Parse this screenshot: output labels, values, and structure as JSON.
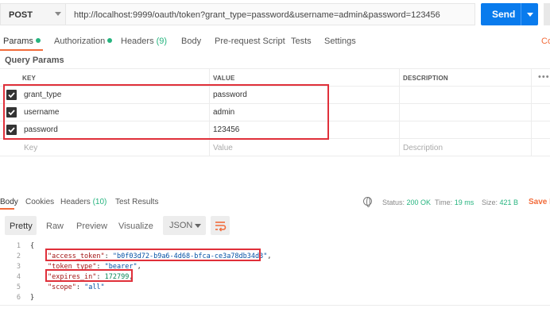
{
  "request": {
    "method": "POST",
    "url": "http://localhost:9999/oauth/token?grant_type=password&username=admin&password=123456",
    "send_label": "Send"
  },
  "tabs": [
    {
      "label": "Params",
      "dot": true
    },
    {
      "label": "Authorization",
      "dot": true
    },
    {
      "label": "Headers",
      "count": "(9)"
    },
    {
      "label": "Body"
    },
    {
      "label": "Pre-request Script"
    },
    {
      "label": "Tests"
    },
    {
      "label": "Settings"
    }
  ],
  "cookies_link": "Co",
  "query_params": {
    "title": "Query Params",
    "columns": [
      "KEY",
      "VALUE",
      "DESCRIPTION"
    ],
    "more": "•••",
    "rows": [
      {
        "checked": true,
        "key": "grant_type",
        "value": "password"
      },
      {
        "checked": true,
        "key": "username",
        "value": "admin"
      },
      {
        "checked": true,
        "key": "password",
        "value": "123456"
      }
    ],
    "placeholder": {
      "key": "Key",
      "value": "Value",
      "description": "Description"
    }
  },
  "response": {
    "tabs": [
      {
        "label": "Body"
      },
      {
        "label": "Cookies"
      },
      {
        "label": "Headers",
        "count": "(10)"
      },
      {
        "label": "Test Results"
      }
    ],
    "status_label": "Status:",
    "status_value": "200 OK",
    "time_label": "Time:",
    "time_value": "19 ms",
    "size_label": "Size:",
    "size_value": "421 B",
    "save_label": "Save R",
    "format_tabs": [
      "Pretty",
      "Raw",
      "Preview",
      "Visualize"
    ],
    "format": "JSON",
    "lines": [
      "1",
      "2",
      "3",
      "4",
      "5",
      "6"
    ],
    "code": {
      "open": "{",
      "access_token_key": "\"access_token\"",
      "access_token_val": "\"b0f03d72-b9a6-4d68-bfca-ce3a78db34d3\"",
      "token_type_key": "\"token_type\"",
      "token_type_val": "\"bearer\"",
      "expires_in_key": "\"expires_in\"",
      "expires_in_val": "172799",
      "scope_key": "\"scope\"",
      "scope_val": "\"all\"",
      "close": "}"
    }
  },
  "colors": {
    "accent": "#f26b3a",
    "send": "#097bed",
    "ok": "#26b47f",
    "highlight": "#e0303a"
  }
}
